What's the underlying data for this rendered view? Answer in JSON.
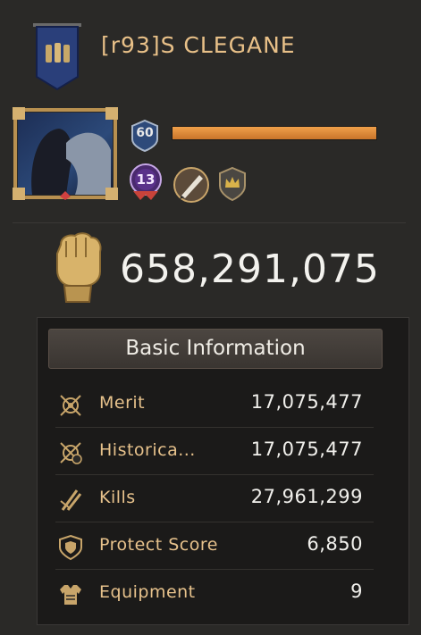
{
  "player": {
    "name": "[r93]S CLEGANE",
    "level": "60",
    "level_progress": 1.0,
    "vip": "13",
    "power": "658,291,075"
  },
  "info": {
    "title": "Basic Information",
    "rows": [
      {
        "label": "Merit",
        "value": "17,075,477",
        "icon": "merit-icon"
      },
      {
        "label": "Historica...",
        "value": "17,075,477",
        "icon": "historical-icon"
      },
      {
        "label": "Kills",
        "value": "27,961,299",
        "icon": "kills-icon"
      },
      {
        "label": "Protect Score",
        "value": "6,850",
        "icon": "shield-icon"
      },
      {
        "label": "Equipment",
        "value": "9",
        "icon": "armor-icon"
      }
    ]
  },
  "colors": {
    "label_gold": "#e7c28c",
    "xp_bar": "#e08c3a",
    "banner_blue": "#2a3f7a"
  }
}
